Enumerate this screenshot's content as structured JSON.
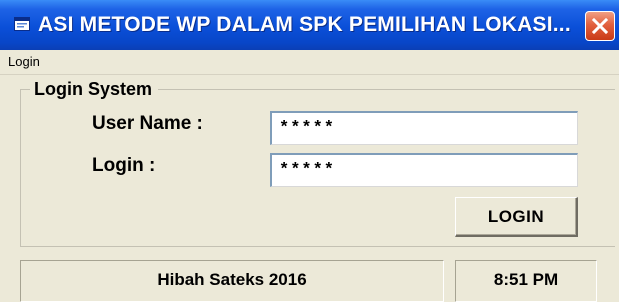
{
  "window": {
    "title": "ASI METODE WP DALAM SPK PEMILIHAN LOKASI..."
  },
  "menu": {
    "items": [
      {
        "label": "Login"
      }
    ]
  },
  "login_group": {
    "legend": "Login System",
    "username_label": "User Name :",
    "username_value": "*****",
    "password_label": "Login :",
    "password_value": "*****",
    "button_label": "LOGIN"
  },
  "statusbar": {
    "left_text": "Hibah Sateks 2016",
    "right_text": "8:51 PM"
  },
  "colors": {
    "titlebar": "#0a4fd8",
    "close_button": "#e2603e",
    "window_face": "#ece9d8"
  },
  "icons": {
    "title": "app-window-icon",
    "close": "close-icon"
  }
}
